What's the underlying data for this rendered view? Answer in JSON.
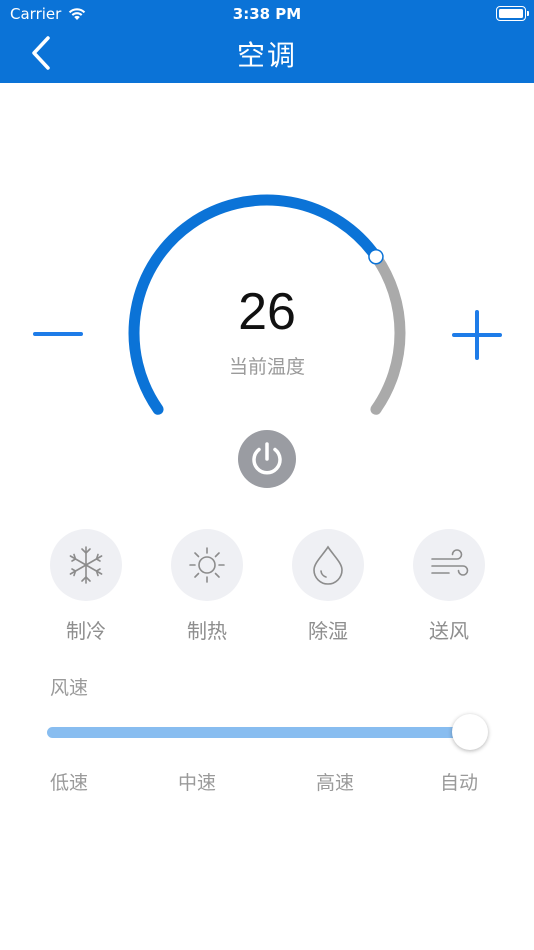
{
  "status_bar": {
    "carrier": "Carrier",
    "time": "3:38 PM"
  },
  "header": {
    "title": "空调",
    "back_icon": "chevron-left-icon"
  },
  "thermostat": {
    "temperature": "26",
    "temperature_label": "当前温度",
    "setpoint_fraction": 0.72,
    "colors": {
      "active_arc": "#0B73D7",
      "inactive_arc": "#AAAAAA",
      "accent": "#1E7CE8"
    }
  },
  "controls": {
    "decrease_icon": "minus-icon",
    "increase_icon": "plus-icon",
    "power_icon": "power-icon"
  },
  "modes": [
    {
      "label": "制冷",
      "icon": "snowflake-icon"
    },
    {
      "label": "制热",
      "icon": "sun-icon"
    },
    {
      "label": "除湿",
      "icon": "droplet-icon"
    },
    {
      "label": "送风",
      "icon": "wind-icon"
    }
  ],
  "fan_speed": {
    "title": "风速",
    "options": [
      "低速",
      "中速",
      "高速",
      "自动"
    ],
    "selected": "自动",
    "level": 1.0
  }
}
